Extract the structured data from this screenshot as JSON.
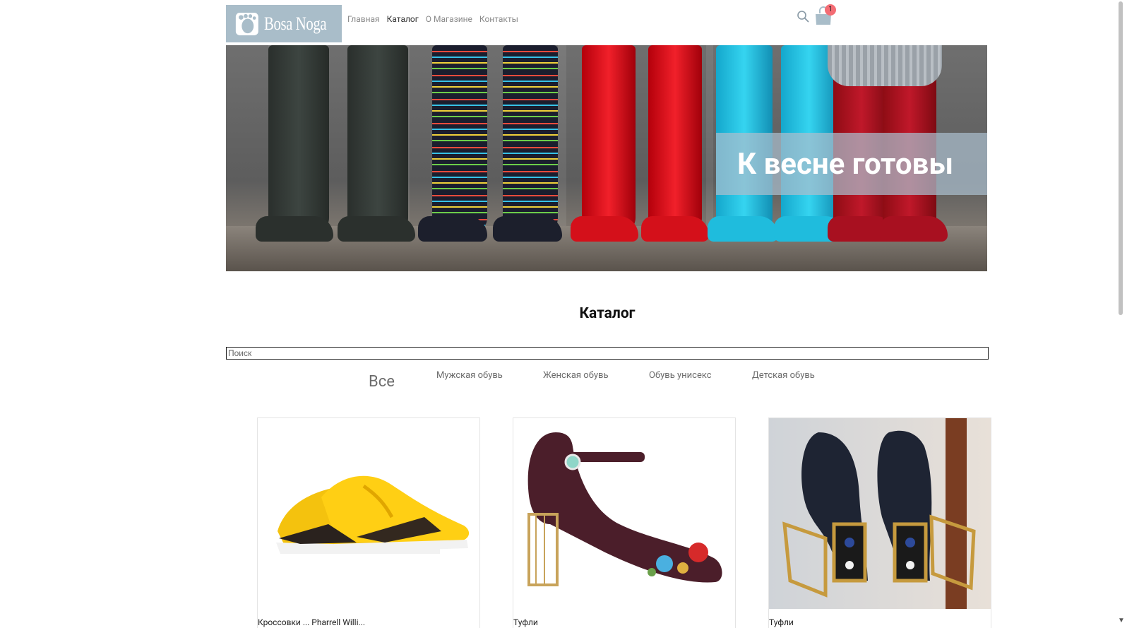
{
  "brand": {
    "logo_text": "Bosa Noga"
  },
  "nav": {
    "items": [
      "Главная",
      "Каталог",
      "О Магазине",
      "Контакты"
    ],
    "active": "Каталог"
  },
  "header": {
    "cart_count": "1",
    "icons": [
      "search-icon",
      "cart-icon"
    ]
  },
  "hero": {
    "title": "К весне готовы"
  },
  "catalog": {
    "title": "Каталог",
    "search_placeholder": "Поиск",
    "filters": [
      "Все",
      "Мужская обувь",
      "Женская обувь",
      "Обувь унисекс",
      "Детская обувь"
    ],
    "products": [
      {
        "name": "Кроссовки ... Pharrell Willi..."
      },
      {
        "name": "Туфли"
      },
      {
        "name": "Туфли"
      }
    ]
  },
  "colors": {
    "logo_bg": "#a9bdc9",
    "banner_bg": "#aabecd",
    "badge": "#f36c74"
  }
}
